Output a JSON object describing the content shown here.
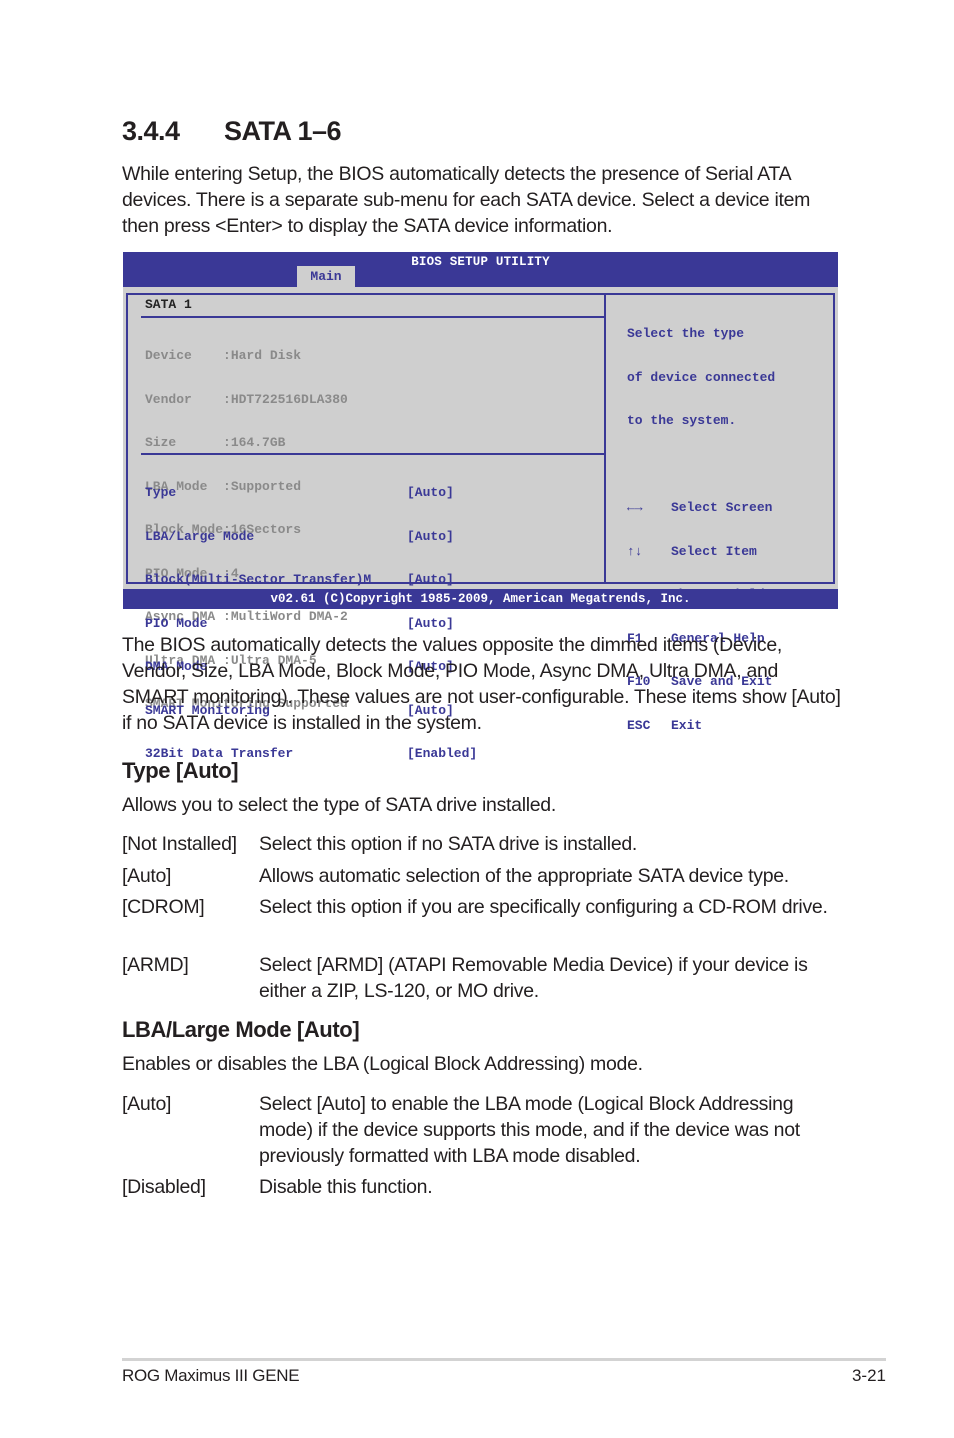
{
  "section": {
    "number": "3.4.4",
    "title": "SATA 1–6"
  },
  "intro": "While entering Setup, the BIOS automatically detects the presence of Serial ATA devices. There is a separate sub-menu for each SATA device. Select a device item then press <Enter> to display the SATA device information.",
  "bios": {
    "title": "BIOS SETUP UTILITY",
    "active_tab": "Main",
    "panel_title": "SATA 1",
    "info": [
      "Device    :Hard Disk",
      "Vendor    :HDT722516DLA380",
      "Size      :164.7GB",
      "LBA Mode  :Supported",
      "Block Mode:16Sectors",
      "PIO Mode  :4",
      "Async DMA :MultiWord DMA-2",
      "Ultra DMA :Ultra DMA-5",
      "SMART Monitoring:Supported"
    ],
    "settings": [
      {
        "label": "Type",
        "value": "[Auto]"
      },
      {
        "label": "LBA/Large Mode",
        "value": "[Auto]"
      },
      {
        "label": "Block(Multi-Sector Transfer)M",
        "value": "[Auto]"
      },
      {
        "label": "PIO Mode",
        "value": "[Auto]"
      },
      {
        "label": "DMA Mode",
        "value": "[Auto]"
      },
      {
        "label": "SMART Monitoring",
        "value": "[Auto]"
      },
      {
        "label": "32Bit Data Transfer",
        "value": "[Enabled]"
      }
    ],
    "help_text": [
      "Select the type",
      "of device connected",
      "to the system."
    ],
    "keys": [
      {
        "key": "←→",
        "action": "Select Screen"
      },
      {
        "key": "↑↓",
        "action": "Select Item"
      },
      {
        "key": "+-",
        "action": "Change Field"
      },
      {
        "key": "F1",
        "action": "General Help"
      },
      {
        "key": "F10",
        "action": "Save and Exit"
      },
      {
        "key": "ESC",
        "action": "Exit"
      }
    ],
    "footer": "v02.61 (C)Copyright 1985-2009, American Megatrends, Inc.",
    "colors": {
      "accent": "#3a3896",
      "panel": "#cfcfcf",
      "dimmed": "#8a8a8a"
    }
  },
  "para2": "The BIOS automatically detects the values opposite the dimmed items (Device, Vendor, Size, LBA Mode, Block Mode, PIO Mode, Async DMA, Ultra DMA, and SMART monitoring). These values are not user-configurable. These items show [Auto] if no SATA device is installed in the system.",
  "type_section": {
    "heading": "Type [Auto]",
    "desc": "Allows you to select the type of SATA drive installed.",
    "options": [
      {
        "key": "[Not Installed]",
        "desc": "Select this option if no SATA drive is installed."
      },
      {
        "key": "[Auto]",
        "desc": "Allows automatic selection of the appropriate SATA device type."
      },
      {
        "key": "[CDROM]",
        "desc": "Select this option if you are specifically configuring a CD-ROM drive."
      },
      {
        "key": "[ARMD]",
        "desc": "Select [ARMD] (ATAPI Removable Media Device) if your device is either a ZIP, LS-120, or MO drive."
      }
    ]
  },
  "lba_section": {
    "heading": "LBA/Large Mode [Auto]",
    "desc": "Enables or disables the LBA (Logical Block Addressing) mode.",
    "options": [
      {
        "key": "[Auto]",
        "desc": "Select [Auto] to enable the LBA mode (Logical Block Addressing mode) if the device supports this mode, and if the device was not previously formatted with LBA mode disabled."
      },
      {
        "key": "[Disabled]",
        "desc": "Disable this function."
      }
    ]
  },
  "footer": {
    "product": "ROG Maximus III GENE",
    "page": "3-21"
  }
}
